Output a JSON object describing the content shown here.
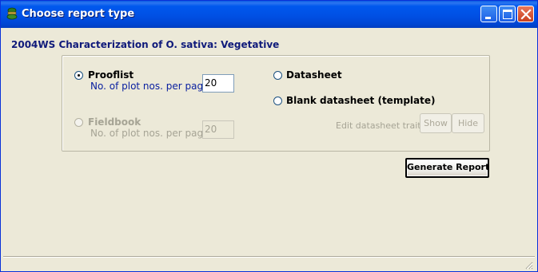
{
  "window": {
    "title": "Choose report type",
    "icon": "green-plant-app-icon",
    "controls": [
      "minimize-icon",
      "maximize-icon",
      "close-icon"
    ]
  },
  "heading": "2004WS Characterization of O. sativa: Vegetative",
  "options": {
    "prooflist": {
      "label": "Prooflist",
      "selected": true,
      "plot_label": "No. of plot nos. per page",
      "plot_value": "20"
    },
    "fieldbook": {
      "label": "Fieldbook",
      "enabled": false,
      "plot_label": "No. of plot nos. per page",
      "plot_value": "20"
    },
    "datasheet": {
      "label": "Datasheet",
      "selected": false
    },
    "blank_datasheet": {
      "label": "Blank datasheet (template)",
      "selected": false
    }
  },
  "traits": {
    "label": "Edit datasheet traits:",
    "show_label": "Show",
    "hide_label": "Hide"
  },
  "generate_label": "Generate Report",
  "colors": {
    "titlebar": "#0054E3",
    "window_bg": "#ECE9D8",
    "heading": "#0F1A7A",
    "link_text": "#0A20A0",
    "disabled_text": "#A6A495"
  }
}
